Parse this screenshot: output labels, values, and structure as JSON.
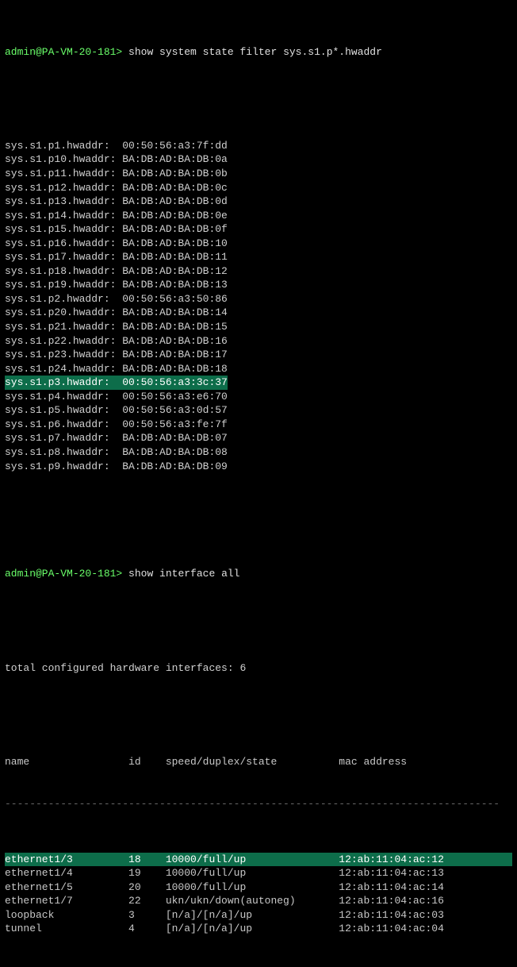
{
  "prompt1": {
    "prefix": "admin@PA-VM-20-181>",
    "command": "show system state filter sys.s1.p*.hwaddr"
  },
  "hwaddr_lines": [
    {
      "key": "sys.s1.p1.hwaddr:",
      "val": "00:50:56:a3:7f:dd",
      "hl": false
    },
    {
      "key": "sys.s1.p10.hwaddr:",
      "val": "BA:DB:AD:BA:DB:0a",
      "hl": false
    },
    {
      "key": "sys.s1.p11.hwaddr:",
      "val": "BA:DB:AD:BA:DB:0b",
      "hl": false
    },
    {
      "key": "sys.s1.p12.hwaddr:",
      "val": "BA:DB:AD:BA:DB:0c",
      "hl": false
    },
    {
      "key": "sys.s1.p13.hwaddr:",
      "val": "BA:DB:AD:BA:DB:0d",
      "hl": false
    },
    {
      "key": "sys.s1.p14.hwaddr:",
      "val": "BA:DB:AD:BA:DB:0e",
      "hl": false
    },
    {
      "key": "sys.s1.p15.hwaddr:",
      "val": "BA:DB:AD:BA:DB:0f",
      "hl": false
    },
    {
      "key": "sys.s1.p16.hwaddr:",
      "val": "BA:DB:AD:BA:DB:10",
      "hl": false
    },
    {
      "key": "sys.s1.p17.hwaddr:",
      "val": "BA:DB:AD:BA:DB:11",
      "hl": false
    },
    {
      "key": "sys.s1.p18.hwaddr:",
      "val": "BA:DB:AD:BA:DB:12",
      "hl": false
    },
    {
      "key": "sys.s1.p19.hwaddr:",
      "val": "BA:DB:AD:BA:DB:13",
      "hl": false
    },
    {
      "key": "sys.s1.p2.hwaddr:",
      "val": "00:50:56:a3:50:86",
      "hl": false
    },
    {
      "key": "sys.s1.p20.hwaddr:",
      "val": "BA:DB:AD:BA:DB:14",
      "hl": false
    },
    {
      "key": "sys.s1.p21.hwaddr:",
      "val": "BA:DB:AD:BA:DB:15",
      "hl": false
    },
    {
      "key": "sys.s1.p22.hwaddr:",
      "val": "BA:DB:AD:BA:DB:16",
      "hl": false
    },
    {
      "key": "sys.s1.p23.hwaddr:",
      "val": "BA:DB:AD:BA:DB:17",
      "hl": false
    },
    {
      "key": "sys.s1.p24.hwaddr:",
      "val": "BA:DB:AD:BA:DB:18",
      "hl": false
    },
    {
      "key": "sys.s1.p3.hwaddr:",
      "val": "00:50:56:a3:3c:37",
      "hl": true
    },
    {
      "key": "sys.s1.p4.hwaddr:",
      "val": "00:50:56:a3:e6:70",
      "hl": false
    },
    {
      "key": "sys.s1.p5.hwaddr:",
      "val": "00:50:56:a3:0d:57",
      "hl": false
    },
    {
      "key": "sys.s1.p6.hwaddr:",
      "val": "00:50:56:a3:fe:7f",
      "hl": false
    },
    {
      "key": "sys.s1.p7.hwaddr:",
      "val": "BA:DB:AD:BA:DB:07",
      "hl": false
    },
    {
      "key": "sys.s1.p8.hwaddr:",
      "val": "BA:DB:AD:BA:DB:08",
      "hl": false
    },
    {
      "key": "sys.s1.p9.hwaddr:",
      "val": "BA:DB:AD:BA:DB:09",
      "hl": false
    }
  ],
  "prompt2": {
    "prefix": "admin@PA-VM-20-181>",
    "command": "show interface all"
  },
  "summary": "total configured hardware interfaces: 6",
  "if_header": {
    "name": "name",
    "id": "id",
    "sds": "speed/duplex/state",
    "mac": "mac address"
  },
  "if_rows": [
    {
      "name": "ethernet1/3",
      "id": "18",
      "sds": "10000/full/up",
      "mac": "12:ab:11:04:ac:12",
      "hl": true
    },
    {
      "name": "ethernet1/4",
      "id": "19",
      "sds": "10000/full/up",
      "mac": "12:ab:11:04:ac:13",
      "hl": false
    },
    {
      "name": "ethernet1/5",
      "id": "20",
      "sds": "10000/full/up",
      "mac": "12:ab:11:04:ac:14",
      "hl": false
    },
    {
      "name": "ethernet1/7",
      "id": "22",
      "sds": "ukn/ukn/down(autoneg)",
      "mac": "12:ab:11:04:ac:16",
      "hl": false
    },
    {
      "name": "loopback",
      "id": "3",
      "sds": "[n/a]/[n/a]/up",
      "mac": "12:ab:11:04:ac:03",
      "hl": false
    },
    {
      "name": "tunnel",
      "id": "4",
      "sds": "[n/a]/[n/a]/up",
      "mac": "12:ab:11:04:ac:04",
      "hl": false
    }
  ],
  "divider": "--------------------------------------------------------------------------------"
}
